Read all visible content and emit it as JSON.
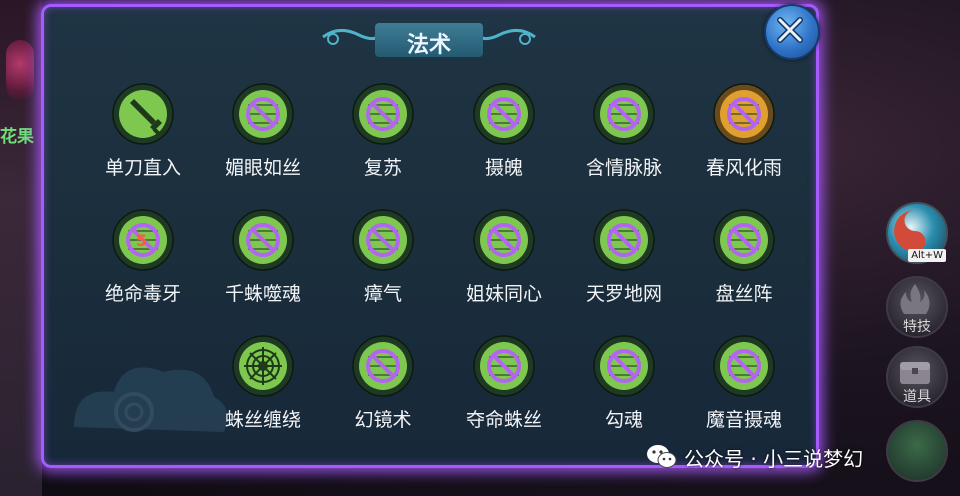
{
  "window": {
    "title": "法术"
  },
  "background": {
    "left_text": "花果"
  },
  "skills": [
    {
      "label": "单刀直入",
      "icon": "sword-skill-icon",
      "locked": false
    },
    {
      "label": "媚眼如丝",
      "icon": "locked-skill-icon",
      "locked": true
    },
    {
      "label": "复苏",
      "icon": "locked-skill-icon",
      "locked": true
    },
    {
      "label": "摄魄",
      "icon": "locked-skill-icon",
      "locked": true
    },
    {
      "label": "含情脉脉",
      "icon": "locked-skill-icon",
      "locked": true
    },
    {
      "label": "春风化雨",
      "icon": "locked-skill-icon-orange",
      "locked": true
    },
    {
      "label": "绝命毒牙",
      "icon": "locked-skill-icon-badge",
      "locked": true,
      "badge": "5"
    },
    {
      "label": "千蛛噬魂",
      "icon": "locked-skill-icon",
      "locked": true
    },
    {
      "label": "瘴气",
      "icon": "locked-skill-icon",
      "locked": true
    },
    {
      "label": "姐妹同心",
      "icon": "locked-skill-icon",
      "locked": true
    },
    {
      "label": "天罗地网",
      "icon": "locked-skill-icon",
      "locked": true
    },
    {
      "label": "盘丝阵",
      "icon": "locked-skill-icon",
      "locked": true
    },
    {
      "label": "蛛丝缠绕",
      "icon": "web-skill-icon",
      "locked": false
    },
    {
      "label": "幻镜术",
      "icon": "locked-skill-icon",
      "locked": true
    },
    {
      "label": "夺命蛛丝",
      "icon": "locked-skill-icon",
      "locked": true
    },
    {
      "label": "勾魂",
      "icon": "locked-skill-icon",
      "locked": true
    },
    {
      "label": "魔音摄魂",
      "icon": "locked-skill-icon",
      "locked": true
    }
  ],
  "side": {
    "hotkey": "Alt+W",
    "special_label": "特技",
    "items_label": "道具"
  },
  "watermark": {
    "text": "公众号 · 小三说梦幻"
  },
  "colors": {
    "panel_border": "#a65bff",
    "icon_ring": "#2f5f2c",
    "icon_fill": "#7fc850",
    "lock_purple": "#b266f0"
  }
}
